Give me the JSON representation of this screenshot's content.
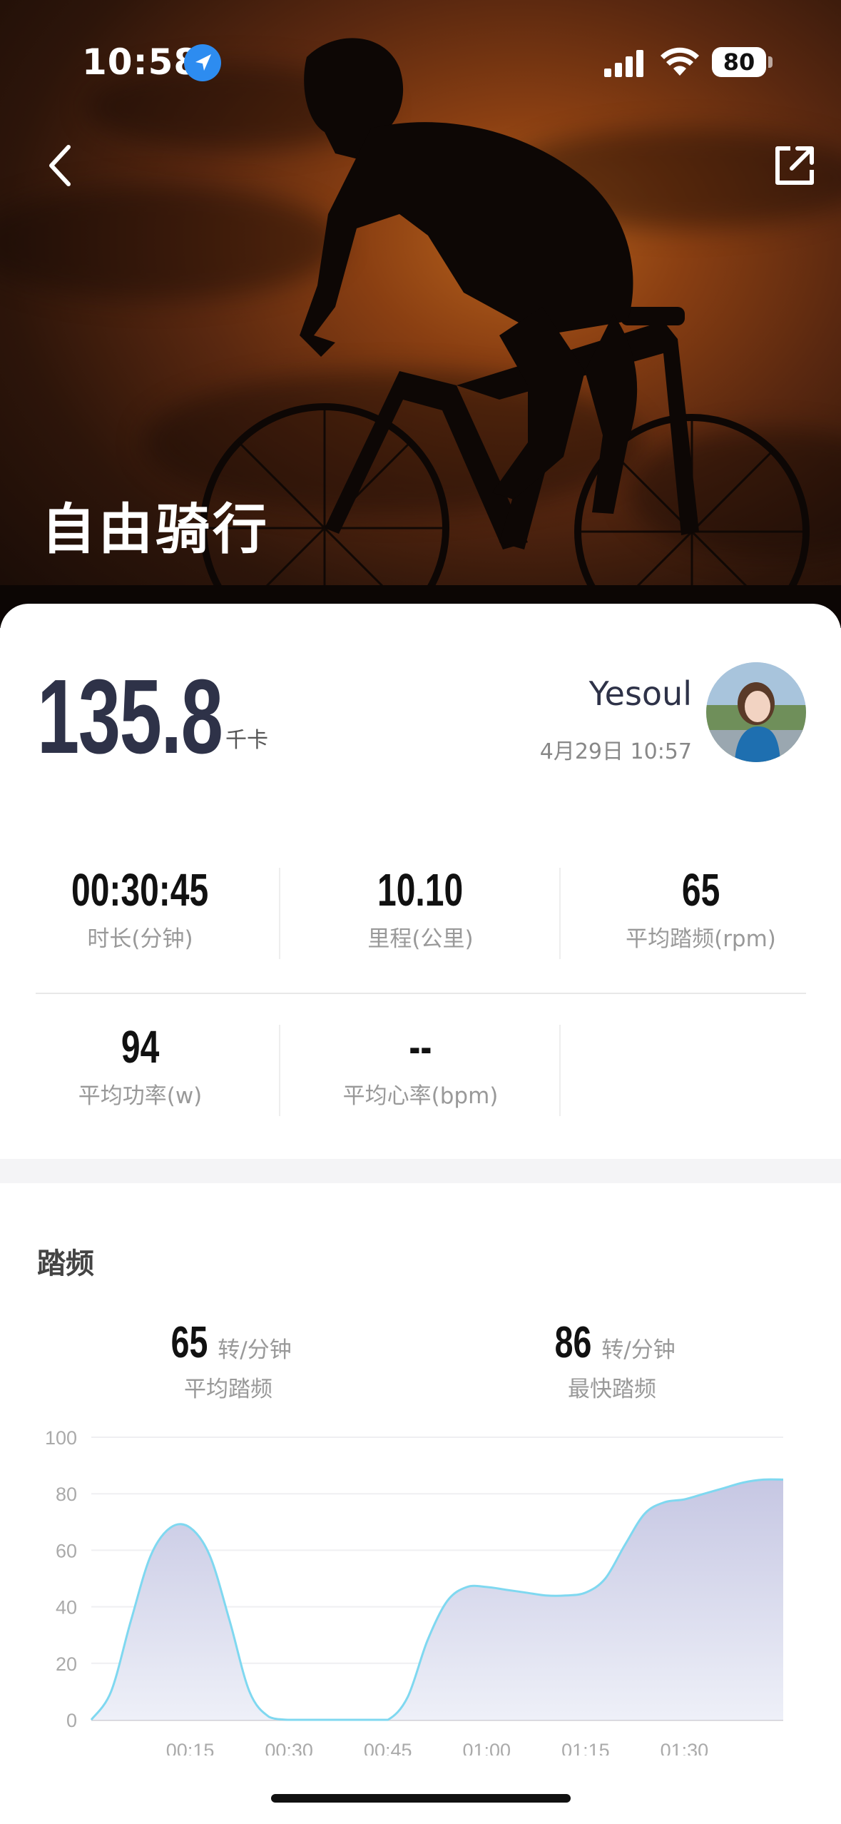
{
  "status_bar": {
    "time": "10:58",
    "battery": "80"
  },
  "header": {
    "title": "自由骑行"
  },
  "summary": {
    "calories": "135.8",
    "calories_unit": "千卡",
    "user_name": "Yesoul",
    "datetime": "4月29日 10:57"
  },
  "stats": [
    {
      "value": "00:30:45",
      "label": "时长(分钟)"
    },
    {
      "value": "10.10",
      "label": "里程(公里)"
    },
    {
      "value": "65",
      "label": "平均踏频(rpm)"
    },
    {
      "value": "94",
      "label": "平均功率(w)"
    },
    {
      "value": "--",
      "label": "平均心率(bpm)"
    }
  ],
  "cadence": {
    "title": "踏频",
    "avg_value": "65",
    "avg_unit": "转/分钟",
    "avg_label": "平均踏频",
    "max_value": "86",
    "max_unit": "转/分钟",
    "max_label": "最快踏频"
  },
  "colors": {
    "accent_line": "#7fd8f0",
    "fill_top": "#c6c7e3",
    "fill_bottom": "#eef0f8",
    "dark_text": "#2e3248"
  },
  "chart_data": {
    "type": "area",
    "x": [
      "00:00",
      "00:03",
      "00:06",
      "00:09",
      "00:12",
      "00:15",
      "00:18",
      "00:21",
      "00:24",
      "00:27",
      "00:30",
      "00:33",
      "00:36",
      "00:39",
      "00:42",
      "00:45",
      "00:48",
      "00:51",
      "00:54",
      "00:57",
      "01:00",
      "01:03",
      "01:06",
      "01:09",
      "01:12",
      "01:15",
      "01:18",
      "01:21",
      "01:24",
      "01:27",
      "01:30",
      "01:33",
      "01:36",
      "01:39",
      "01:42",
      "01:45"
    ],
    "values": [
      0,
      10,
      35,
      58,
      68,
      68,
      58,
      35,
      10,
      1,
      0,
      0,
      0,
      0,
      0,
      0,
      8,
      28,
      42,
      47,
      47,
      46,
      45,
      44,
      44,
      45,
      50,
      62,
      73,
      77,
      78,
      80,
      82,
      84,
      85,
      85
    ],
    "xticks": [
      "00:15",
      "00:30",
      "00:45",
      "01:00",
      "01:15",
      "01:30"
    ],
    "yticks": [
      "0",
      "20",
      "40",
      "60",
      "80",
      "100"
    ],
    "ylim": [
      0,
      100
    ],
    "grid": true
  }
}
